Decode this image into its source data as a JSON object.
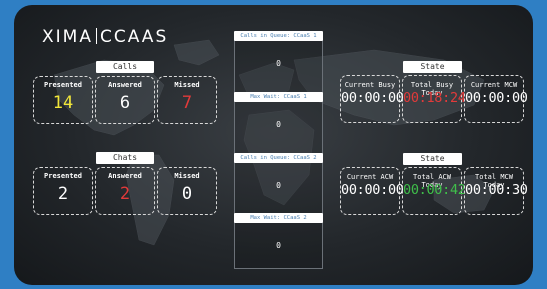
{
  "logo": {
    "left": "XIMA",
    "right": "CCAAS"
  },
  "calls": {
    "tag": "Calls",
    "presented_label": "Presented",
    "presented": "14",
    "answered_label": "Answered",
    "answered": "6",
    "missed_label": "Missed",
    "missed": "7"
  },
  "chats": {
    "tag": "Chats",
    "presented_label": "Presented",
    "presented": "2",
    "answered_label": "Answered",
    "answered": "2",
    "missed_label": "Missed",
    "missed": "0"
  },
  "queue": {
    "calls_in_queue_1_label": "Calls in Queue: CCaaS 1",
    "calls_in_queue_1": "0",
    "max_wait_1_label": "Max Wait: CCaaS 1",
    "max_wait_1": "0",
    "calls_in_queue_2_label": "Calls in Queue: CCaaS 2",
    "calls_in_queue_2": "0",
    "max_wait_2_label": "Max Wait: CCaaS 2",
    "max_wait_2": "0"
  },
  "state_top": {
    "tag": "State",
    "current_busy_label": "Current Busy",
    "current_busy": "00:00:00",
    "total_busy_label": "Total Busy Today",
    "total_busy": "00:18:24",
    "current_mcw_label": "Current MCW",
    "current_mcw": "00:00:00"
  },
  "state_bottom": {
    "tag": "State",
    "current_acw_label": "Current ACW",
    "current_acw": "00:00:00",
    "total_acw_label": "Total ACW Today",
    "total_acw": "00:00:42",
    "total_mcw_label": "Total MCW Today",
    "total_mcw": "00:00:30"
  },
  "colors": {
    "background": "#2f7fc4",
    "presented_calls": "#f1e63a",
    "missed_calls": "#e23a3a",
    "answered_chats": "#e23a3a",
    "total_busy": "#e23a3a",
    "total_acw": "#3fbf4a"
  }
}
